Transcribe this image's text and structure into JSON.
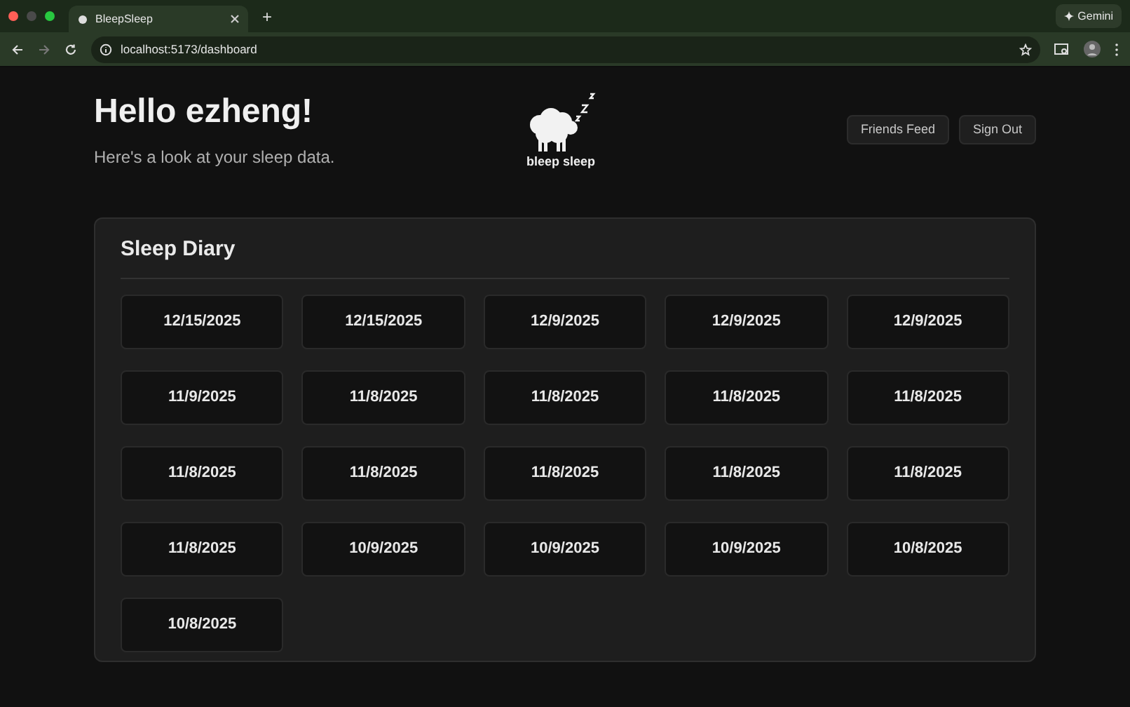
{
  "browser": {
    "tab_title": "BleepSleep",
    "new_tab": "+",
    "gemini": "Gemini",
    "url": "localhost:5173/dashboard"
  },
  "header": {
    "greeting": "Hello ezheng!",
    "subtitle": "Here's a look at your sleep data.",
    "logo_text": "bleep sleep",
    "buttons": [
      "Friends Feed",
      "Sign Out"
    ]
  },
  "diary": {
    "title": "Sleep Diary",
    "entries": [
      "12/15/2025",
      "12/15/2025",
      "12/9/2025",
      "12/9/2025",
      "12/9/2025",
      "11/9/2025",
      "11/8/2025",
      "11/8/2025",
      "11/8/2025",
      "11/8/2025",
      "11/8/2025",
      "11/8/2025",
      "11/8/2025",
      "11/8/2025",
      "11/8/2025",
      "11/8/2025",
      "10/9/2025",
      "10/9/2025",
      "10/9/2025",
      "10/8/2025",
      "10/8/2025"
    ]
  }
}
